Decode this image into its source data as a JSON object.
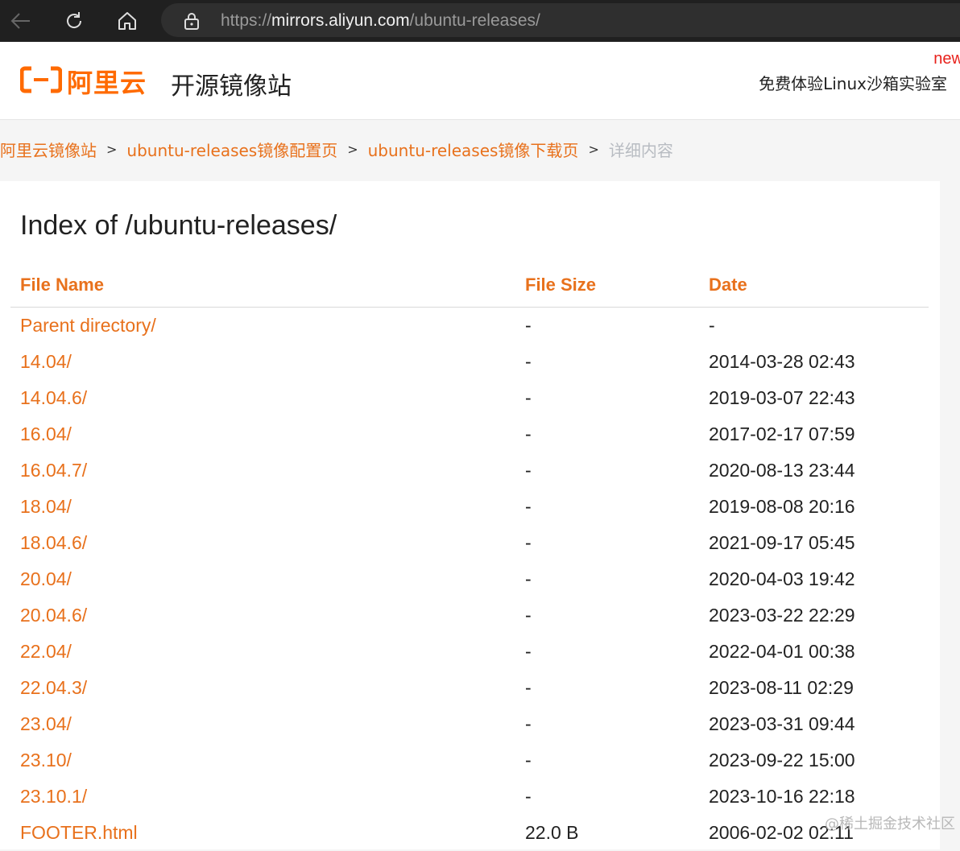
{
  "browser": {
    "url_scheme": "https://",
    "url_host": "mirrors.aliyun.com",
    "url_path": "/ubuntu-releases/",
    "icons": [
      "back-arrow-icon",
      "refresh-icon",
      "home-icon",
      "lock-icon"
    ]
  },
  "header": {
    "logo_text": "阿里云",
    "site_title": "开源镜像站",
    "new_badge": "new",
    "promo_link": "免费体验Linux沙箱实验室"
  },
  "breadcrumb": {
    "items": [
      "阿里云镜像站",
      "ubuntu-releases镜像配置页",
      "ubuntu-releases镜像下载页"
    ],
    "separator": ">",
    "current": "详细内容"
  },
  "listing": {
    "heading": "Index of /ubuntu-releases/",
    "columns": [
      "File Name",
      "File Size",
      "Date"
    ],
    "rows": [
      {
        "name": "Parent directory/",
        "size": "-",
        "date": "-"
      },
      {
        "name": "14.04/",
        "size": "-",
        "date": "2014-03-28 02:43"
      },
      {
        "name": "14.04.6/",
        "size": "-",
        "date": "2019-03-07 22:43"
      },
      {
        "name": "16.04/",
        "size": "-",
        "date": "2017-02-17 07:59"
      },
      {
        "name": "16.04.7/",
        "size": "-",
        "date": "2020-08-13 23:44"
      },
      {
        "name": "18.04/",
        "size": "-",
        "date": "2019-08-08 20:16"
      },
      {
        "name": "18.04.6/",
        "size": "-",
        "date": "2021-09-17 05:45"
      },
      {
        "name": "20.04/",
        "size": "-",
        "date": "2020-04-03 19:42"
      },
      {
        "name": "20.04.6/",
        "size": "-",
        "date": "2023-03-22 22:29"
      },
      {
        "name": "22.04/",
        "size": "-",
        "date": "2022-04-01 00:38"
      },
      {
        "name": "22.04.3/",
        "size": "-",
        "date": "2023-08-11 02:29"
      },
      {
        "name": "23.04/",
        "size": "-",
        "date": "2023-03-31 09:44"
      },
      {
        "name": "23.10/",
        "size": "-",
        "date": "2023-09-22 15:00"
      },
      {
        "name": "23.10.1/",
        "size": "-",
        "date": "2023-10-16 22:18"
      },
      {
        "name": "FOOTER.html",
        "size": "22.0 B",
        "date": "2006-02-02 02:11"
      }
    ]
  },
  "watermark": "@稀土掘金技术社区",
  "colors": {
    "accent": "#e8711c",
    "brand": "#ff6a00",
    "badge": "#e8211b",
    "toolbar": "#202020"
  }
}
